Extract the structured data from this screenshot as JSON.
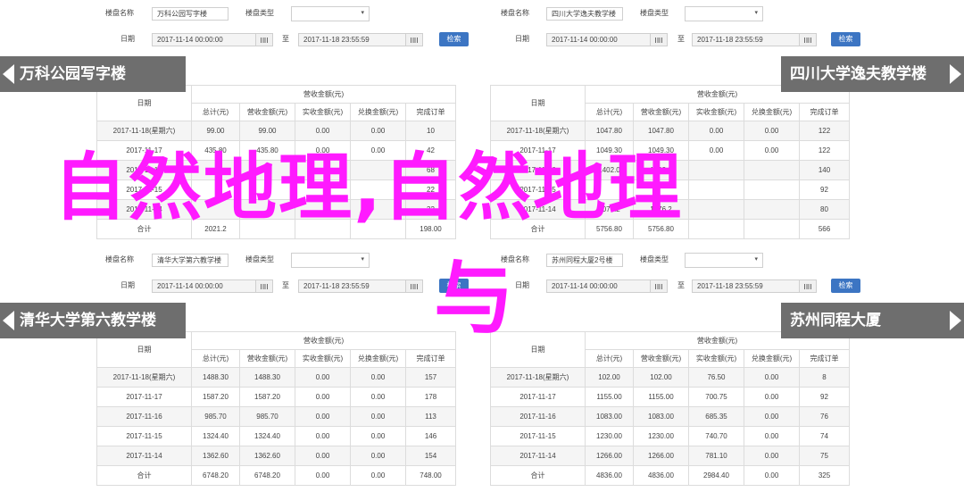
{
  "panels": [
    {
      "fields": {
        "label_name": "楼盘名称",
        "name": "万科公园写字楼",
        "label_type": "楼盘类型",
        "label_date": "日期",
        "date_from": "2017-11-14 00:00:00",
        "sep": "至",
        "date_to": "2017-11-18 23:55:59",
        "search": "检索"
      },
      "banner": "万科公园写字楼",
      "table": {
        "h_date": "日期",
        "h_group": "营收金额(元)",
        "cols": [
          "总计(元)",
          "营收金额(元)",
          "实收金额(元)",
          "兑换金额(元)",
          "完成订单"
        ],
        "rows": [
          [
            "2017-11-18(星期六)",
            "99.00",
            "99.00",
            "0.00",
            "0.00",
            "10"
          ],
          [
            "2017-11-17",
            "435.80",
            "435.80",
            "0.00",
            "0.00",
            "42"
          ],
          [
            "2017-11-16",
            "",
            "",
            "",
            "",
            "68"
          ],
          [
            "2017-11-15",
            "",
            "",
            "",
            "",
            "22"
          ],
          [
            "2017-11-14",
            "",
            "",
            "",
            "",
            "32"
          ],
          [
            "合计",
            "2021.2",
            "",
            "",
            "",
            "198.00"
          ]
        ]
      }
    },
    {
      "fields": {
        "label_name": "楼盘名称",
        "name": "四川大学逸夫教学楼",
        "label_type": "楼盘类型",
        "label_date": "日期",
        "date_from": "2017-11-14 00:00:00",
        "sep": "至",
        "date_to": "2017-11-18 23:55:59",
        "search": "检索"
      },
      "banner": "四川大学逸夫教学楼",
      "table": {
        "h_date": "日期",
        "h_group": "营收金额(元)",
        "cols": [
          "总计(元)",
          "营收金额(元)",
          "实收金额(元)",
          "兑换金额(元)",
          "完成订单"
        ],
        "rows": [
          [
            "2017-11-18(星期六)",
            "1047.80",
            "1047.80",
            "0.00",
            "0.00",
            "122"
          ],
          [
            "2017-11-17",
            "1049.30",
            "1049.30",
            "0.00",
            "0.00",
            "122"
          ],
          [
            "2017-11-16",
            "1402.0",
            "1402.0",
            "",
            "",
            "140"
          ],
          [
            "2017-11-15",
            "",
            "",
            "",
            "",
            "92"
          ],
          [
            "2017-11-14",
            "1076.2",
            "1076.2",
            "",
            "",
            "80"
          ],
          [
            "合计",
            "5756.80",
            "5756.80",
            "",
            "",
            "566"
          ]
        ]
      }
    },
    {
      "fields": {
        "label_name": "楼盘名称",
        "name": "清华大学第六教学楼",
        "label_type": "楼盘类型",
        "label_date": "日期",
        "date_from": "2017-11-14 00:00:00",
        "sep": "至",
        "date_to": "2017-11-18 23:55:59",
        "search": "检索"
      },
      "banner": "清华大学第六教学楼",
      "table": {
        "h_date": "日期",
        "h_group": "营收金额(元)",
        "cols": [
          "总计(元)",
          "营收金额(元)",
          "实收金额(元)",
          "兑换金额(元)",
          "完成订单"
        ],
        "rows": [
          [
            "2017-11-18(星期六)",
            "1488.30",
            "1488.30",
            "0.00",
            "0.00",
            "157"
          ],
          [
            "2017-11-17",
            "1587.20",
            "1587.20",
            "0.00",
            "0.00",
            "178"
          ],
          [
            "2017-11-16",
            "985.70",
            "985.70",
            "0.00",
            "0.00",
            "113"
          ],
          [
            "2017-11-15",
            "1324.40",
            "1324.40",
            "0.00",
            "0.00",
            "146"
          ],
          [
            "2017-11-14",
            "1362.60",
            "1362.60",
            "0.00",
            "0.00",
            "154"
          ],
          [
            "合计",
            "6748.20",
            "6748.20",
            "0.00",
            "0.00",
            "748.00"
          ]
        ]
      }
    },
    {
      "fields": {
        "label_name": "楼盘名称",
        "name": "苏州同程大厦2号楼",
        "label_type": "楼盘类型",
        "label_date": "日期",
        "date_from": "2017-11-14 00:00:00",
        "sep": "至",
        "date_to": "2017-11-18 23:55:59",
        "search": "检索"
      },
      "banner": "苏州同程大厦",
      "table": {
        "h_date": "日期",
        "h_group": "营收金额(元)",
        "cols": [
          "总计(元)",
          "营收金额(元)",
          "实收金额(元)",
          "兑换金额(元)",
          "完成订单"
        ],
        "rows": [
          [
            "2017-11-18(星期六)",
            "102.00",
            "102.00",
            "76.50",
            "0.00",
            "8"
          ],
          [
            "2017-11-17",
            "1155.00",
            "1155.00",
            "700.75",
            "0.00",
            "92"
          ],
          [
            "2017-11-16",
            "1083.00",
            "1083.00",
            "685.35",
            "0.00",
            "76"
          ],
          [
            "2017-11-15",
            "1230.00",
            "1230.00",
            "740.70",
            "0.00",
            "74"
          ],
          [
            "2017-11-14",
            "1266.00",
            "1266.00",
            "781.10",
            "0.00",
            "75"
          ],
          [
            "合计",
            "4836.00",
            "4836.00",
            "2984.40",
            "0.00",
            "325"
          ]
        ]
      }
    }
  ],
  "overlay": {
    "line1": "自然地理,自然地理",
    "line2": "与",
    "color": "#ff1aff"
  }
}
